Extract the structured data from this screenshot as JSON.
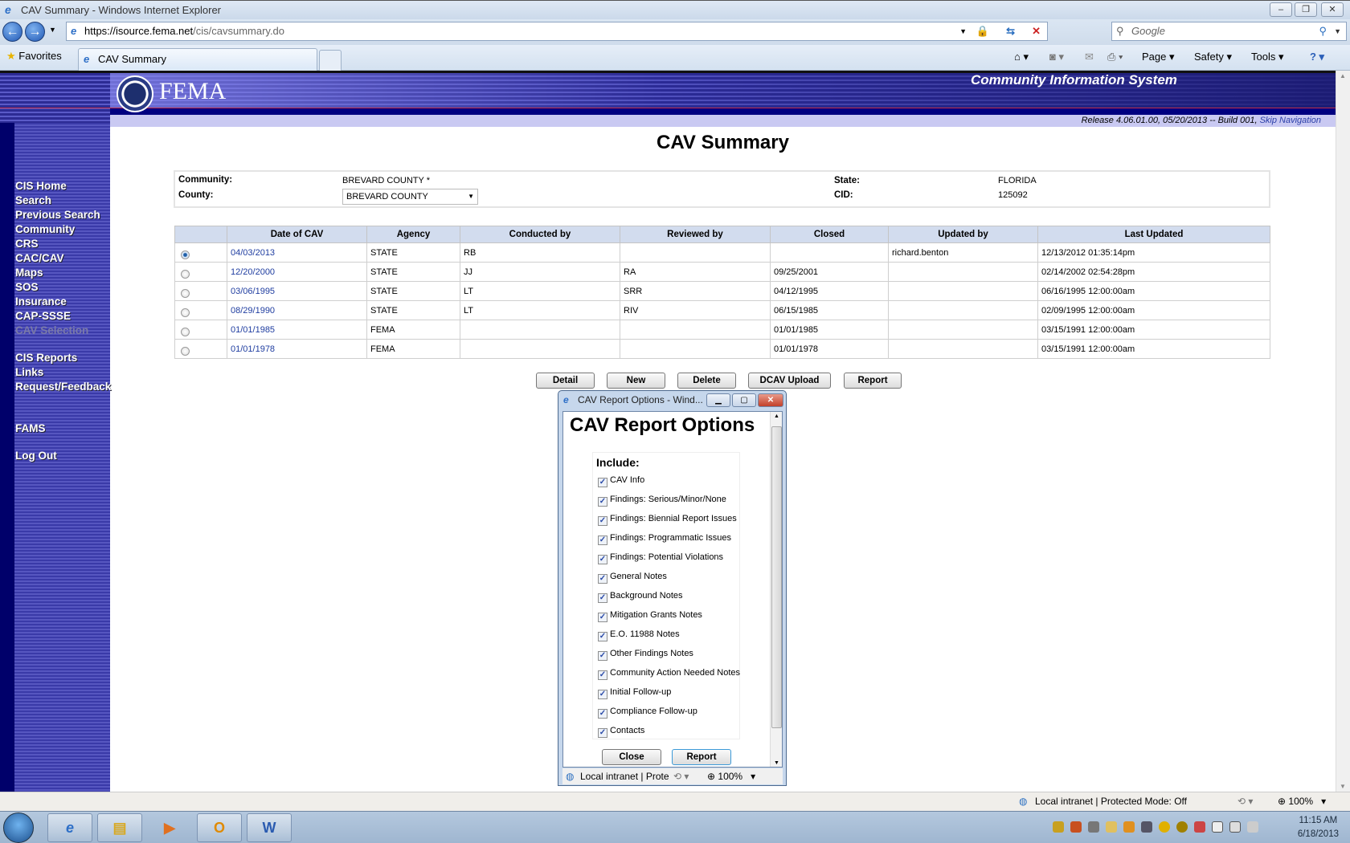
{
  "browser": {
    "window_title": "CAV Summary - Windows Internet Explorer",
    "url_host": "https://isource.fema.net",
    "url_path": "/cis/cavsummary.do",
    "search_placeholder": "Google",
    "favorites_label": "Favorites",
    "tab_label": "CAV Summary",
    "commands": {
      "page": "Page",
      "safety": "Safety",
      "tools": "Tools"
    },
    "status_zone": "Local intranet | Protected Mode: Off",
    "zoom": "100%"
  },
  "header": {
    "logo_text": "FEMA",
    "system_name": "Community Information System",
    "release": "Release 4.06.01.00, 05/20/2013 -- Build 001,",
    "skip_nav": "Skip Navigation"
  },
  "sidebar": {
    "items": [
      {
        "label": "CIS Home"
      },
      {
        "label": "Search"
      },
      {
        "label": "Previous Search"
      },
      {
        "label": "Community"
      },
      {
        "label": "CRS"
      },
      {
        "label": "CAC/CAV"
      },
      {
        "label": "Maps"
      },
      {
        "label": "SOS"
      },
      {
        "label": "Insurance"
      },
      {
        "label": "CAP-SSSE"
      },
      {
        "label": "CAV Selection"
      },
      {
        "label": "CIS Reports"
      },
      {
        "label": "Links"
      },
      {
        "label": "Request/Feedback"
      },
      {
        "label": "FAMS"
      },
      {
        "label": "Log Out"
      }
    ]
  },
  "page": {
    "title": "CAV Summary",
    "info": {
      "community_label": "Community:",
      "community_value": "BREVARD COUNTY *",
      "county_label": "County:",
      "county_value": "BREVARD COUNTY",
      "state_label": "State:",
      "state_value": "FLORIDA",
      "cid_label": "CID:",
      "cid_value": "125092"
    },
    "table": {
      "headers": [
        "",
        "Date of CAV",
        "Agency",
        "Conducted by",
        "Reviewed by",
        "Closed",
        "Updated by",
        "Last Updated"
      ],
      "rows": [
        {
          "selected": true,
          "date": "04/03/2013",
          "agency": "STATE",
          "conducted": "RB",
          "reviewed": "",
          "closed": "",
          "updated_by": "richard.benton",
          "last_updated": "12/13/2012 01:35:14pm"
        },
        {
          "selected": false,
          "date": "12/20/2000",
          "agency": "STATE",
          "conducted": "JJ",
          "reviewed": "RA",
          "closed": "09/25/2001",
          "updated_by": "",
          "last_updated": "02/14/2002 02:54:28pm"
        },
        {
          "selected": false,
          "date": "03/06/1995",
          "agency": "STATE",
          "conducted": "LT",
          "reviewed": "SRR",
          "closed": "04/12/1995",
          "updated_by": "",
          "last_updated": "06/16/1995 12:00:00am"
        },
        {
          "selected": false,
          "date": "08/29/1990",
          "agency": "STATE",
          "conducted": "LT",
          "reviewed": "RIV",
          "closed": "06/15/1985",
          "updated_by": "",
          "last_updated": "02/09/1995 12:00:00am"
        },
        {
          "selected": false,
          "date": "01/01/1985",
          "agency": "FEMA",
          "conducted": "",
          "reviewed": "",
          "closed": "01/01/1985",
          "updated_by": "",
          "last_updated": "03/15/1991 12:00:00am"
        },
        {
          "selected": false,
          "date": "01/01/1978",
          "agency": "FEMA",
          "conducted": "",
          "reviewed": "",
          "closed": "01/01/1978",
          "updated_by": "",
          "last_updated": "03/15/1991 12:00:00am"
        }
      ]
    },
    "buttons": {
      "detail": "Detail",
      "new": "New",
      "delete": "Delete",
      "dcav_upload": "DCAV Upload",
      "report": "Report"
    }
  },
  "dialog": {
    "window_title": "CAV Report Options - Wind...",
    "heading": "CAV Report Options",
    "include_label": "Include:",
    "options": [
      {
        "label": "CAV Info",
        "checked": true
      },
      {
        "label": "Findings: Serious/Minor/None",
        "checked": true
      },
      {
        "label": "Findings: Biennial Report Issues",
        "checked": true
      },
      {
        "label": "Findings: Programmatic Issues",
        "checked": true
      },
      {
        "label": "Findings: Potential Violations",
        "checked": true
      },
      {
        "label": "General Notes",
        "checked": true
      },
      {
        "label": "Background Notes",
        "checked": true
      },
      {
        "label": "Mitigation Grants Notes",
        "checked": true
      },
      {
        "label": "E.O. 11988 Notes",
        "checked": true
      },
      {
        "label": "Other Findings Notes",
        "checked": true
      },
      {
        "label": "Community Action Needed Notes",
        "checked": true
      },
      {
        "label": "Initial Follow-up",
        "checked": true
      },
      {
        "label": "Compliance Follow-up",
        "checked": true
      },
      {
        "label": "Contacts",
        "checked": true
      }
    ],
    "close_label": "Close",
    "report_label": "Report",
    "status_zone": "Local intranet | Prote",
    "zoom": "100%"
  },
  "taskbar": {
    "time": "11:15 AM",
    "date": "6/18/2013"
  }
}
